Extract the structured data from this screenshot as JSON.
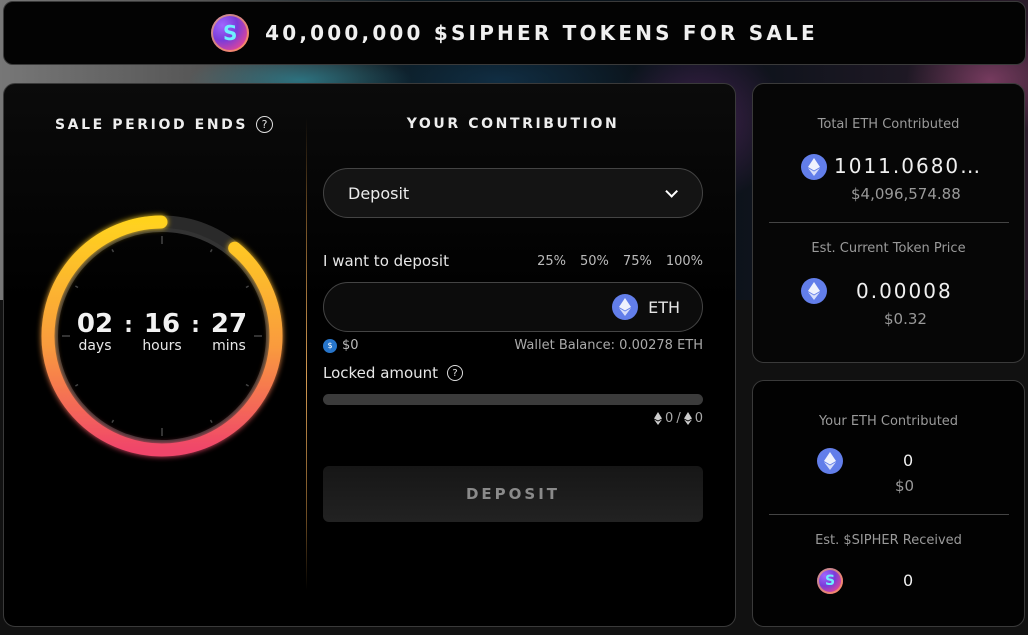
{
  "header": {
    "title": "40,000,000 $SIPHER TOKENS FOR SALE",
    "logo_icon": "sipher-token-icon",
    "logo_glyph": "S"
  },
  "timer": {
    "title": "SALE PERIOD ENDS",
    "help_glyph": "?",
    "days": "02",
    "hours": "16",
    "mins": "27",
    "days_label": "days",
    "hours_label": "hours",
    "mins_label": "mins",
    "separator": ":",
    "remaining_fraction": 0.89,
    "colors": {
      "start": "#ffd21f",
      "end": "#f0456a",
      "track": "#2a2a2a"
    }
  },
  "contribution": {
    "title": "YOUR CONTRIBUTION",
    "mode_select": {
      "value": "Deposit"
    },
    "deposit_label": "I want to deposit",
    "percent_options": [
      "25%",
      "50%",
      "75%",
      "100%"
    ],
    "amount_input": {
      "value": "",
      "placeholder": ""
    },
    "currency": "ETH",
    "usd_value": "$0",
    "usd_glyph": "$",
    "wallet_balance": "Wallet Balance: 0.00278 ETH",
    "locked_label": "Locked amount",
    "locked_progress": 0,
    "locked_current": "0",
    "locked_separator": "/",
    "locked_total": "0",
    "button_label": "DEPOSIT"
  },
  "stats": {
    "total_eth_label": "Total ETH Contributed",
    "total_eth_value": "1011.0680…",
    "total_eth_usd": "$4,096,574.88",
    "token_price_label": "Est. Current Token Price",
    "token_price_value": "0.00008",
    "token_price_usd": "$0.32",
    "your_eth_label": "Your ETH Contributed",
    "your_eth_value": "0",
    "your_eth_usd": "$0",
    "sipher_received_label": "Est. $SIPHER Received",
    "sipher_received_value": "0",
    "sipher_glyph": "S"
  },
  "colors": {
    "eth": "#627eea",
    "accent": "#d49a52",
    "border": "#3a3a3a"
  }
}
